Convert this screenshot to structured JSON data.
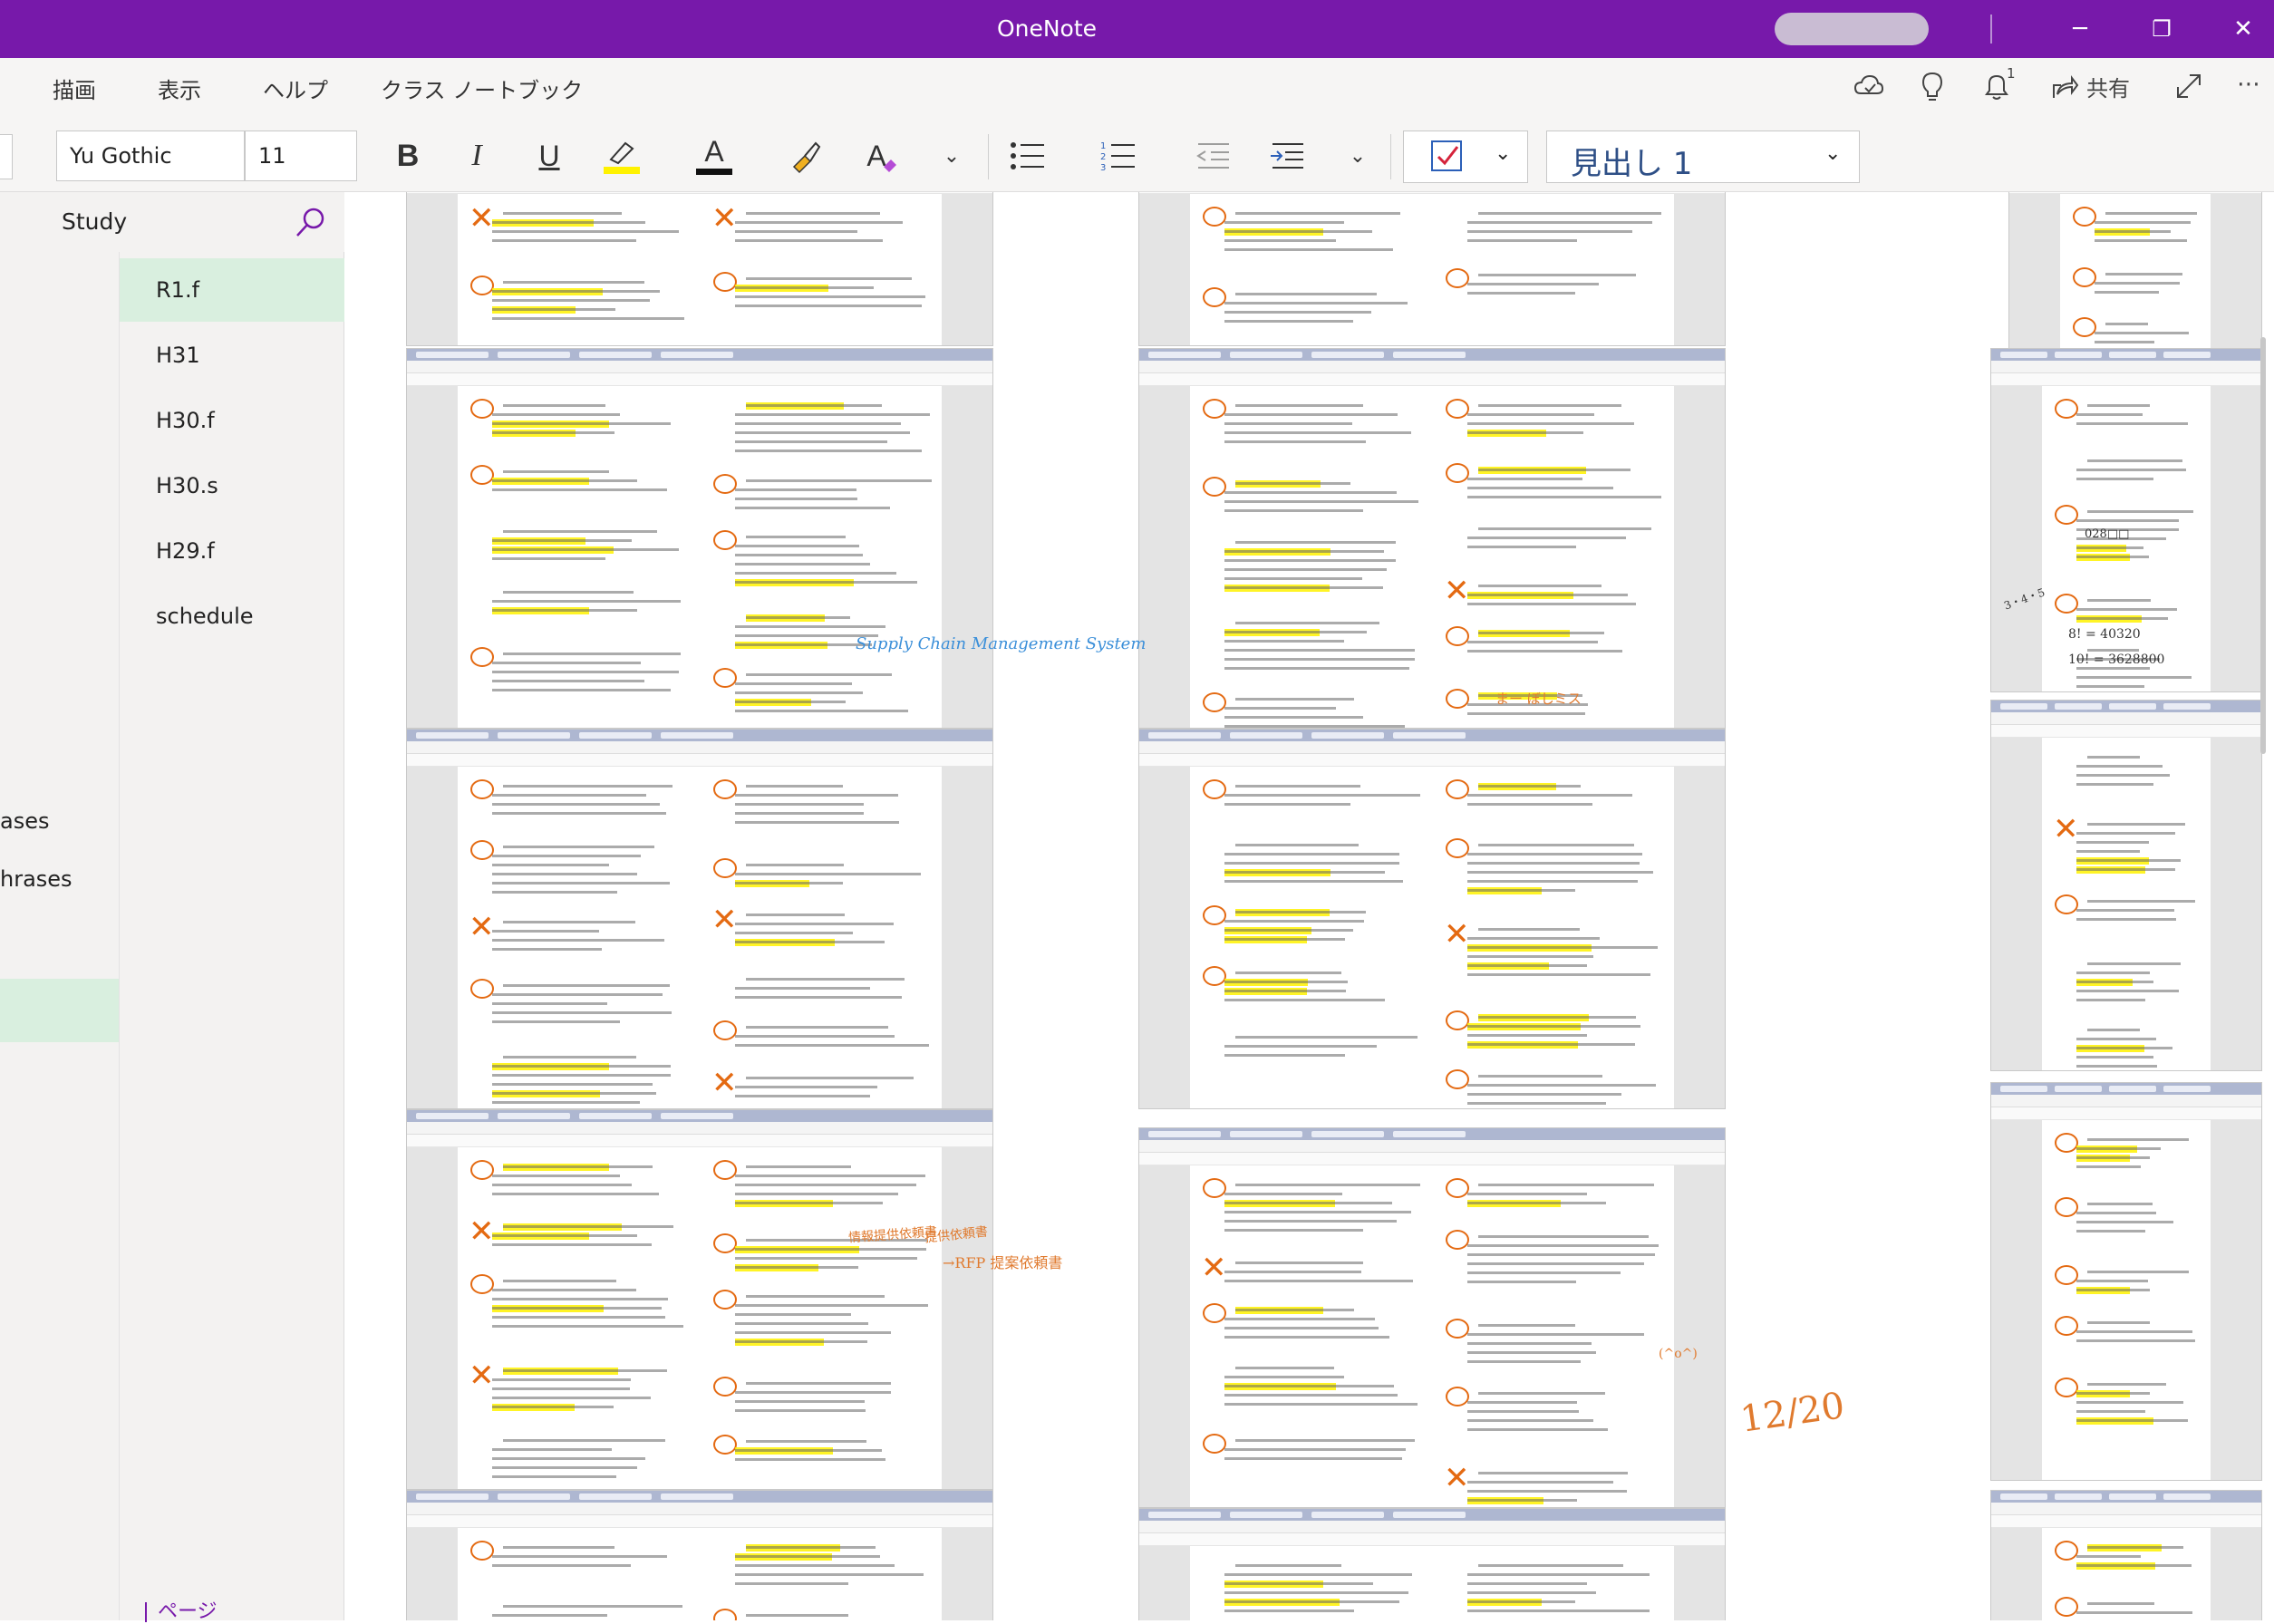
{
  "app": {
    "title": "OneNote"
  },
  "window_controls": {
    "minimize": "─",
    "restore": "❐",
    "close": "✕"
  },
  "menu": {
    "tabs": [
      "描画",
      "表示",
      "ヘルプ",
      "クラス ノートブック"
    ],
    "share_label": "共有",
    "notification_count": "1"
  },
  "ribbon": {
    "font_name": "Yu Gothic",
    "font_size": "11",
    "bold": "B",
    "italic": "I",
    "underline": "U",
    "font_color_glyph": "A",
    "clear_format_glyph": "A",
    "style": "見出し 1",
    "highlight_color": "#fff200",
    "font_color": "#111111"
  },
  "notebook": {
    "section_title": "Study",
    "pages": [
      "R1.f",
      "H31",
      "H30.f",
      "H30.s",
      "H29.f",
      "schedule"
    ],
    "selected_page": "R1.f",
    "section_partial": [
      "ases",
      "hrases"
    ],
    "add_page_label": "ページ"
  },
  "canvas": {
    "annotations": [
      "Supply Chain Management System",
      "12/20",
      "→RFP 提案依頼書",
      "提供依頼書",
      "情報提供依頼書",
      "まー ぼしミス",
      "(^o^)"
    ],
    "math_notes": [
      "8! = 40320",
      "10! = 3628800",
      "028□□",
      "3・4・5"
    ]
  },
  "colors": {
    "accent": "#7719aa",
    "selected_page_bg": "#d9efdf",
    "ink_orange": "#e46a12",
    "ink_blue": "#3b8fd9"
  }
}
